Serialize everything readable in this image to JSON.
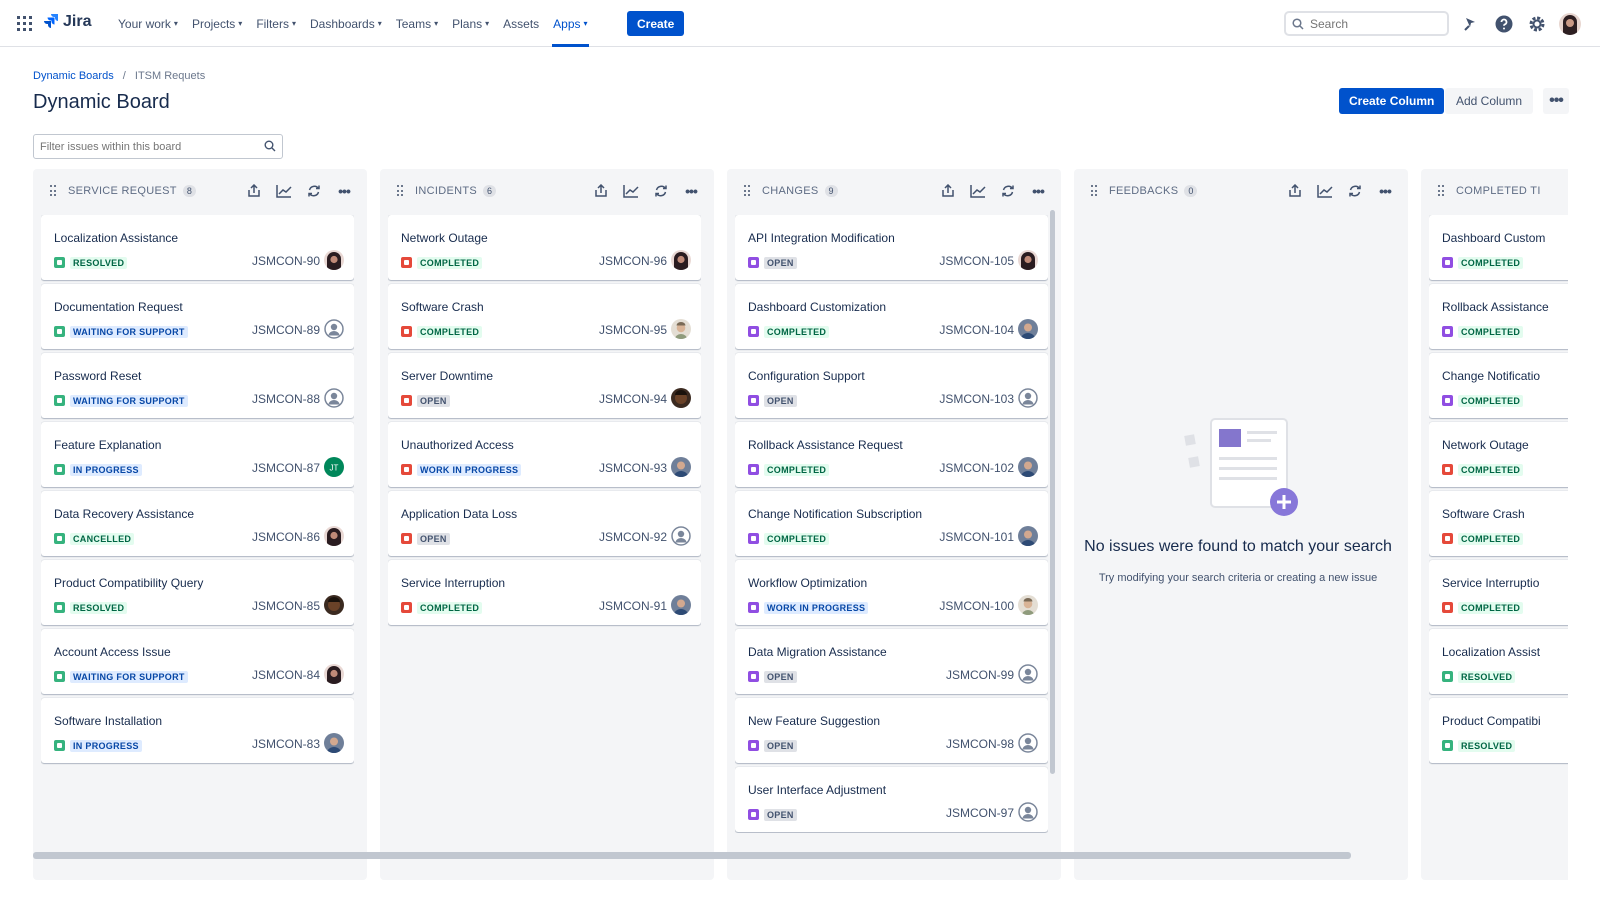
{
  "nav": {
    "logo_text": "Jira",
    "items": [
      {
        "label": "Your work",
        "chevron": true
      },
      {
        "label": "Projects",
        "chevron": true
      },
      {
        "label": "Filters",
        "chevron": true
      },
      {
        "label": "Dashboards",
        "chevron": true
      },
      {
        "label": "Teams",
        "chevron": true
      },
      {
        "label": "Plans",
        "chevron": true
      },
      {
        "label": "Assets",
        "chevron": false
      },
      {
        "label": "Apps",
        "chevron": true,
        "active": true
      }
    ],
    "create_label": "Create",
    "search_placeholder": "Search"
  },
  "breadcrumb": {
    "parent": "Dynamic Boards",
    "separator": "/",
    "current": "ITSM Requets"
  },
  "page_title": "Dynamic Board",
  "actions": {
    "create_column": "Create Column",
    "add_column": "Add Column",
    "more": "•••"
  },
  "filter_placeholder": "Filter issues within this board",
  "colors": {
    "accent": "#0052cc",
    "service": "#36b37e",
    "incident": "#e5493a",
    "change": "#904ee2"
  },
  "columns": [
    {
      "title": "SERVICE REQUEST",
      "count": "8",
      "type_color": "#36b37e",
      "cards": [
        {
          "title": "Localization Assistance",
          "status": "RESOLVED",
          "status_style": "green",
          "key": "JSMCON-90",
          "avatar": "woman-dark"
        },
        {
          "title": "Documentation Request",
          "status": "WAITING FOR SUPPORT",
          "status_style": "blue",
          "key": "JSMCON-89",
          "avatar": "default"
        },
        {
          "title": "Password Reset",
          "status": "WAITING FOR SUPPORT",
          "status_style": "blue",
          "key": "JSMCON-88",
          "avatar": "default"
        },
        {
          "title": "Feature Explanation",
          "status": "IN PROGRESS",
          "status_style": "blue",
          "key": "JSMCON-87",
          "avatar": "initials",
          "initials": "JT"
        },
        {
          "title": "Data Recovery Assistance",
          "status": "CANCELLED",
          "status_style": "green",
          "key": "JSMCON-86",
          "avatar": "woman-dark"
        },
        {
          "title": "Product Compatibility Query",
          "status": "RESOLVED",
          "status_style": "green",
          "key": "JSMCON-85",
          "avatar": "man-brown"
        },
        {
          "title": "Account Access Issue",
          "status": "WAITING FOR SUPPORT",
          "status_style": "blue",
          "key": "JSMCON-84",
          "avatar": "woman-dark"
        },
        {
          "title": "Software Installation",
          "status": "IN PROGRESS",
          "status_style": "blue",
          "key": "JSMCON-83",
          "avatar": "man-blue"
        }
      ]
    },
    {
      "title": "INCIDENTS",
      "count": "6",
      "type_color": "#e5493a",
      "cards": [
        {
          "title": "Network Outage",
          "status": "COMPLETED",
          "status_style": "green",
          "key": "JSMCON-96",
          "avatar": "woman-dark"
        },
        {
          "title": "Software Crash",
          "status": "COMPLETED",
          "status_style": "green",
          "key": "JSMCON-95",
          "avatar": "man-light"
        },
        {
          "title": "Server Downtime",
          "status": "OPEN",
          "status_style": "grey",
          "key": "JSMCON-94",
          "avatar": "man-brown"
        },
        {
          "title": "Unauthorized Access",
          "status": "WORK IN PROGRESS",
          "status_style": "blue",
          "key": "JSMCON-93",
          "avatar": "man-blue"
        },
        {
          "title": "Application Data Loss",
          "status": "OPEN",
          "status_style": "grey",
          "key": "JSMCON-92",
          "avatar": "default"
        },
        {
          "title": "Service Interruption",
          "status": "COMPLETED",
          "status_style": "green",
          "key": "JSMCON-91",
          "avatar": "man-blue"
        }
      ]
    },
    {
      "title": "CHANGES",
      "count": "9",
      "type_color": "#904ee2",
      "cards": [
        {
          "title": "API Integration Modification",
          "status": "OPEN",
          "status_style": "grey",
          "key": "JSMCON-105",
          "avatar": "woman-dark"
        },
        {
          "title": "Dashboard Customization",
          "status": "COMPLETED",
          "status_style": "green",
          "key": "JSMCON-104",
          "avatar": "man-blue"
        },
        {
          "title": "Configuration Support",
          "status": "OPEN",
          "status_style": "grey",
          "key": "JSMCON-103",
          "avatar": "default"
        },
        {
          "title": "Rollback Assistance Request",
          "status": "COMPLETED",
          "status_style": "green",
          "key": "JSMCON-102",
          "avatar": "man-blue"
        },
        {
          "title": "Change Notification Subscription",
          "status": "COMPLETED",
          "status_style": "green",
          "key": "JSMCON-101",
          "avatar": "man-blue"
        },
        {
          "title": "Workflow Optimization",
          "status": "WORK IN PROGRESS",
          "status_style": "blue",
          "key": "JSMCON-100",
          "avatar": "man-light"
        },
        {
          "title": "Data Migration Assistance",
          "status": "OPEN",
          "status_style": "grey",
          "key": "JSMCON-99",
          "avatar": "default"
        },
        {
          "title": "New Feature Suggestion",
          "status": "OPEN",
          "status_style": "grey",
          "key": "JSMCON-98",
          "avatar": "default"
        },
        {
          "title": "User Interface Adjustment",
          "status": "OPEN",
          "status_style": "grey",
          "key": "JSMCON-97",
          "avatar": "default"
        }
      ]
    },
    {
      "title": "FEEDBACKS",
      "count": "0",
      "type_color": "#36b37e",
      "cards": [],
      "empty_title": "No issues were found to match your search",
      "empty_subtitle": "Try modifying your search criteria or creating a new issue"
    },
    {
      "title": "COMPLETED TI",
      "count": "",
      "type_color": "#904ee2",
      "cards": [
        {
          "title": "Dashboard Custom",
          "status": "COMPLETED",
          "status_style": "green",
          "type": "change"
        },
        {
          "title": "Rollback Assistance",
          "status": "COMPLETED",
          "status_style": "green",
          "type": "change"
        },
        {
          "title": "Change Notificatio",
          "status": "COMPLETED",
          "status_style": "green",
          "type": "change"
        },
        {
          "title": "Network Outage",
          "status": "COMPLETED",
          "status_style": "green",
          "type": "incident"
        },
        {
          "title": "Software Crash",
          "status": "COMPLETED",
          "status_style": "green",
          "type": "incident"
        },
        {
          "title": "Service Interruptio",
          "status": "COMPLETED",
          "status_style": "green",
          "type": "incident"
        },
        {
          "title": "Localization Assist",
          "status": "RESOLVED",
          "status_style": "green",
          "type": "service"
        },
        {
          "title": "Product Compatibi",
          "status": "RESOLVED",
          "status_style": "green",
          "type": "service"
        }
      ]
    }
  ]
}
